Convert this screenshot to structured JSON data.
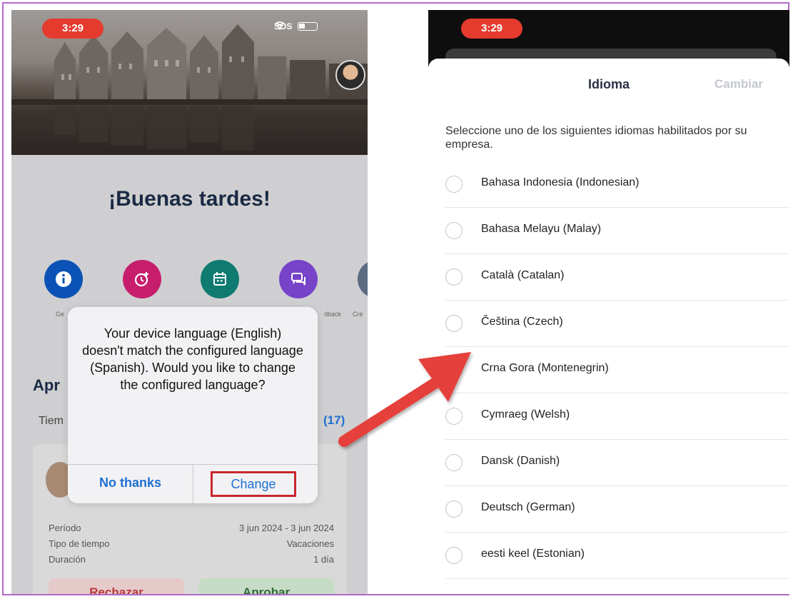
{
  "left_screen": {
    "status_time": "3:29",
    "status_carrier": "SOS",
    "greeting": "¡Buenas tardes!",
    "quick_actions": [
      {
        "label": "Ge",
        "color": "#0a52b5"
      },
      {
        "label": "",
        "color": "#c61e6d"
      },
      {
        "label": "",
        "color": "#0f7a70"
      },
      {
        "label": "dback",
        "color": "#7743c8"
      },
      {
        "label": "Cre",
        "color": "#5a6b82"
      }
    ],
    "section_title": "Apr",
    "section_subtitle": "Tiem",
    "section_count": "(17)",
    "card": {
      "rows": [
        {
          "key": "Período",
          "value": "3 jun 2024 - 3 jun 2024"
        },
        {
          "key": "Tipo de tiempo",
          "value": "Vacaciones"
        },
        {
          "key": "Duración",
          "value": "1 día"
        }
      ],
      "reject_label": "Rechazar",
      "approve_label": "Aprobar"
    },
    "dialog": {
      "message": "Your device language (English) doesn't match the configured language (Spanish). Would you like to change the configured language?",
      "no_label": "No thanks",
      "change_label": "Change"
    }
  },
  "right_screen": {
    "status_time": "3:29",
    "title": "Idioma",
    "action_label": "Cambiar",
    "instructions": "Seleccione uno de los siguientes idiomas habilitados por su empresa.",
    "languages": [
      "Bahasa Indonesia (Indonesian)",
      "Bahasa Melayu (Malay)",
      "Català (Catalan)",
      "Čeština (Czech)",
      "Crna Gora (Montenegrin)",
      "Cymraeg (Welsh)",
      "Dansk (Danish)",
      "Deutsch (German)",
      "eesti keel (Estonian)"
    ]
  },
  "colors": {
    "accent_blue": "#1e6fd0",
    "highlight_red": "#c9282d",
    "arrow_red": "#e5403a",
    "frame_purple": "#b06ac8"
  }
}
